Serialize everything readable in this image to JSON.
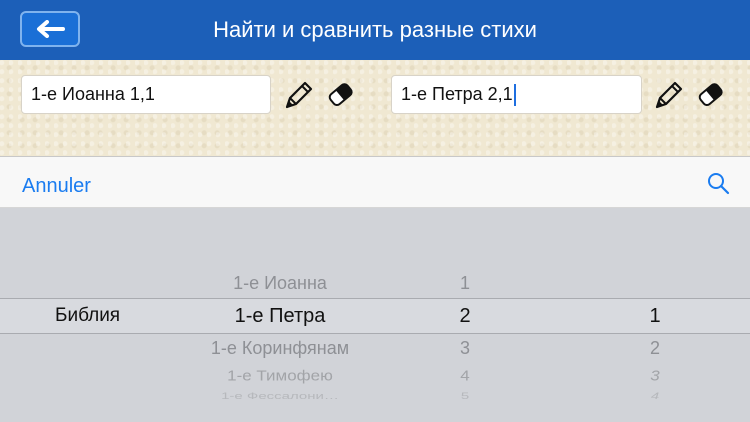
{
  "header": {
    "title": "Найти и сравнить разные стихи",
    "back_icon": "arrow-left-icon"
  },
  "verses": {
    "left": {
      "value": "1-е Иоанна 1,1"
    },
    "right": {
      "value": "1-е Петра 2,1"
    }
  },
  "toolbar": {
    "cancel_label": "Annuler",
    "search_icon": "search-icon"
  },
  "picker": {
    "label": "Библия",
    "books": [
      "1-е Иоанна",
      "1-е Петра",
      "1-е Коринфянам",
      "1-е Тимофею",
      "1-е Фессалони…"
    ],
    "chapters": [
      "1",
      "2",
      "3",
      "4",
      "5"
    ],
    "verses": [
      "",
      "1",
      "2",
      "3",
      "4"
    ],
    "selected_book": "1-е Петра",
    "selected_chapter": "2",
    "selected_verse": "1"
  },
  "colors": {
    "header": "#1c5fb8",
    "accent": "#1a7cf0",
    "parchment": "#f0e8d2",
    "picker_bg": "#d1d3d8"
  }
}
